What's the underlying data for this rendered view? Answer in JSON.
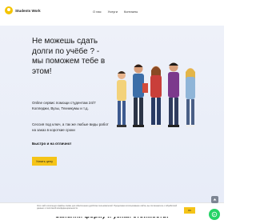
{
  "header": {
    "logo_text": "Students Work",
    "nav": [
      "О нас",
      "Услуги",
      "Контакты"
    ]
  },
  "hero": {
    "headline": "Не можешь сдать долги по учёбе ? - мы поможем тебе в этом!",
    "sub1": "Online сервис помощи студентам 24/7 Колледжи, Вузы, Техникумы и т.д.",
    "sub2": "Сессия под ключ, а так же любые виды работ на заказ в короткие сроки",
    "tagline": "Быстро и на отлично!",
    "cta_label": "Узнать цену"
  },
  "form_title": "Заполни форму и узнай стоимость!",
  "cookie": {
    "text": "Этот сайт использует файлы cookie для обеспечения удобства пользователей. Продолжая использование сайта, вы соглашаетесь с обработкой данных и политикой конфиденциальности.",
    "button": "OK"
  },
  "colors": {
    "accent": "#f5c418",
    "whatsapp": "#25d366",
    "hero_bg": "#eef1f9"
  },
  "icons": {
    "logo": "smiley-logo-icon",
    "whatsapp": "whatsapp-icon",
    "scroll": "arrow-up-icon"
  }
}
